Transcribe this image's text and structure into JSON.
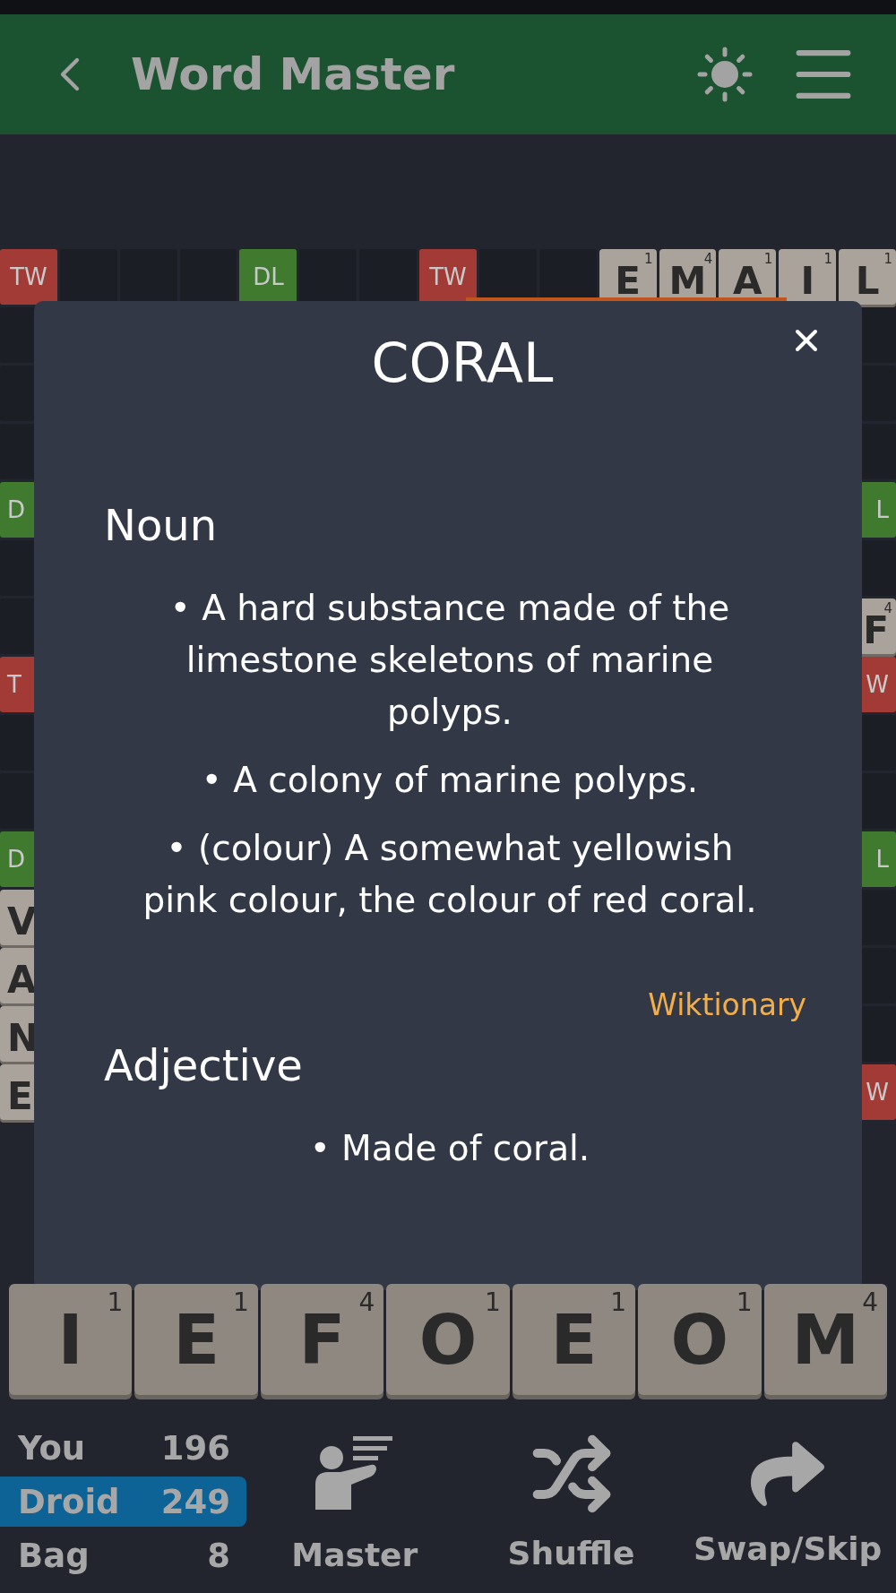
{
  "header": {
    "title": "Word Master"
  },
  "board": {
    "top_row": [
      {
        "kind": "premium",
        "label": "TW",
        "color": "#a23a36"
      },
      {
        "kind": "empty"
      },
      {
        "kind": "empty"
      },
      {
        "kind": "empty"
      },
      {
        "kind": "premium",
        "label": "DL",
        "color": "#3f7a2f"
      },
      {
        "kind": "empty"
      },
      {
        "kind": "empty"
      },
      {
        "kind": "premium",
        "label": "TW",
        "color": "#a23a36"
      },
      {
        "kind": "empty"
      },
      {
        "kind": "empty"
      },
      {
        "kind": "tile",
        "letter": "E",
        "points": "1"
      },
      {
        "kind": "tile",
        "letter": "M",
        "points": "4"
      },
      {
        "kind": "tile",
        "letter": "A",
        "points": "1"
      },
      {
        "kind": "tile",
        "letter": "I",
        "points": "1"
      },
      {
        "kind": "tile",
        "letter": "L",
        "points": "1"
      }
    ],
    "rows": [
      {
        "left": {
          "kind": "empty"
        },
        "right": {
          "kind": "empty"
        }
      },
      {
        "left": {
          "kind": "empty"
        },
        "right": {
          "kind": "empty"
        }
      },
      {
        "left": {
          "kind": "empty"
        },
        "right": {
          "kind": "empty"
        }
      },
      {
        "left": {
          "kind": "premium",
          "label": "D",
          "color": "#3f7a2f"
        },
        "right": {
          "kind": "premium",
          "label": "L",
          "color": "#3f7a2f"
        }
      },
      {
        "left": {
          "kind": "empty"
        },
        "right": {
          "kind": "empty"
        }
      },
      {
        "left": {
          "kind": "empty"
        },
        "right": {
          "kind": "tile",
          "letter": "F",
          "points": "4"
        }
      },
      {
        "left": {
          "kind": "premium",
          "label": "T",
          "color": "#a23a36"
        },
        "right": {
          "kind": "premium",
          "label": "W",
          "color": "#a23a36"
        }
      },
      {
        "left": {
          "kind": "empty"
        },
        "right": {
          "kind": "empty"
        }
      },
      {
        "left": {
          "kind": "empty"
        },
        "right": {
          "kind": "empty"
        }
      },
      {
        "left": {
          "kind": "premium",
          "label": "D",
          "color": "#3f7a2f"
        },
        "right": {
          "kind": "premium",
          "label": "L",
          "color": "#3f7a2f"
        }
      },
      {
        "left": {
          "kind": "tile",
          "letter": "V"
        },
        "right": {
          "kind": "empty"
        }
      },
      {
        "left": {
          "kind": "tile",
          "letter": "A"
        },
        "right": {
          "kind": "empty"
        }
      },
      {
        "left": {
          "kind": "tile",
          "letter": "N"
        },
        "right": {
          "kind": "empty"
        }
      },
      {
        "left": {
          "kind": "tile",
          "letter": "E"
        },
        "right": {
          "kind": "premium",
          "label": "W",
          "color": "#a23a36"
        }
      }
    ]
  },
  "dialog": {
    "title": "CORAL",
    "sections": [
      {
        "part_of_speech": "Noun",
        "definitions": [
          "• A hard substance made of the limestone skeletons of marine polyps.",
          "• A colony of marine polyps.",
          "• (colour) A somewhat yellowish pink colour, the colour of red coral."
        ],
        "source": "Wiktionary"
      },
      {
        "part_of_speech": "Adjective",
        "definitions": [
          "• Made of coral."
        ]
      }
    ]
  },
  "rack": [
    {
      "letter": "I",
      "points": "1"
    },
    {
      "letter": "E",
      "points": "1"
    },
    {
      "letter": "F",
      "points": "4"
    },
    {
      "letter": "O",
      "points": "1"
    },
    {
      "letter": "E",
      "points": "1"
    },
    {
      "letter": "O",
      "points": "1"
    },
    {
      "letter": "M",
      "points": "4"
    }
  ],
  "scores": [
    {
      "label": "You",
      "value": "196",
      "selected": false
    },
    {
      "label": "Droid",
      "value": "249",
      "selected": true
    },
    {
      "label": "Bag",
      "value": "8",
      "selected": false
    }
  ],
  "actions": [
    {
      "kind": "master",
      "label": "Master"
    },
    {
      "kind": "shuffle",
      "label": "Shuffle"
    },
    {
      "kind": "swap",
      "label": "Swap/Skip"
    }
  ]
}
